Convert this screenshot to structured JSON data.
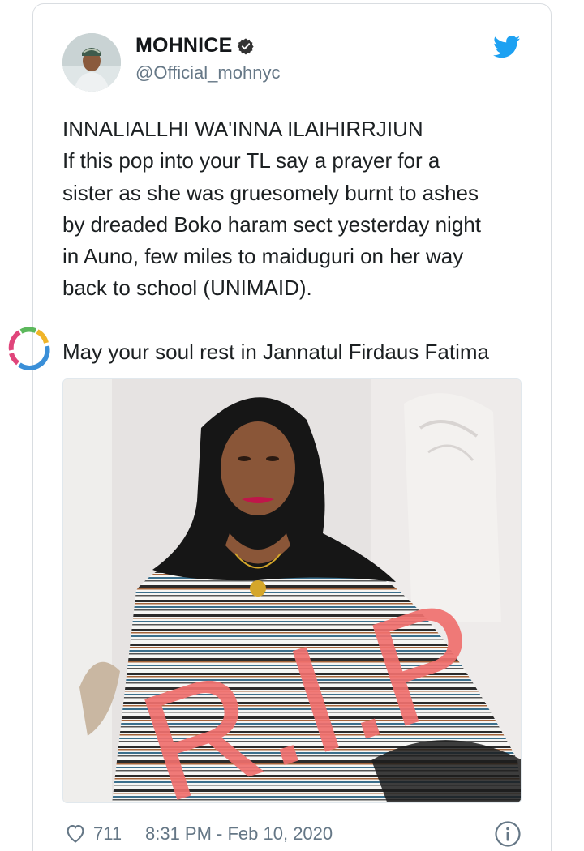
{
  "author": {
    "display_name": "MOHNICE",
    "handle": "@Official_mohnyc"
  },
  "tweet": {
    "lines": [
      "INNALIALLHI WA'INNA ILAIHIRRJIUN",
      "If this pop into your TL say a prayer for a",
      "sister as she was gruesomely burnt to ashes",
      "by dreaded Boko haram sect yesterday night",
      "in Auno, few miles to maiduguri on her way",
      "back to school (UNIMAID).",
      "May your soul rest in Jannatul Firdaus Fatima"
    ],
    "image_overlay_text": "R.I.P"
  },
  "footer": {
    "likes": "711",
    "timestamp": "8:31 PM - Feb 10, 2020"
  },
  "colors": {
    "twitter_blue": "#1da1f2",
    "muted": "#657786",
    "rip_red": "#f0706e"
  },
  "icons": [
    "verified-icon",
    "twitter-bird-icon",
    "heart-icon",
    "info-icon",
    "loading-spinner-icon"
  ]
}
